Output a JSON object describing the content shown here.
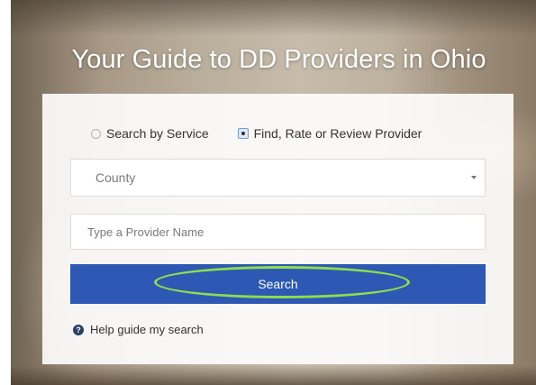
{
  "hero": {
    "title": "Your Guide to DD Providers in Ohio"
  },
  "search_form": {
    "mode_options": [
      {
        "label": "Search by Service",
        "selected": false
      },
      {
        "label": "Find, Rate or Review Provider",
        "selected": true
      }
    ],
    "county_select": {
      "selected": "County"
    },
    "provider_input": {
      "placeholder": "Type a Provider Name",
      "value": ""
    },
    "search_button": {
      "label": "Search"
    },
    "help_link": {
      "icon": "question-circle-icon",
      "label": "Help guide my search"
    }
  },
  "colors": {
    "button_blue": "#2d58b4",
    "highlight_green": "#8fdc4e",
    "panel_bg": "#ffffff"
  }
}
